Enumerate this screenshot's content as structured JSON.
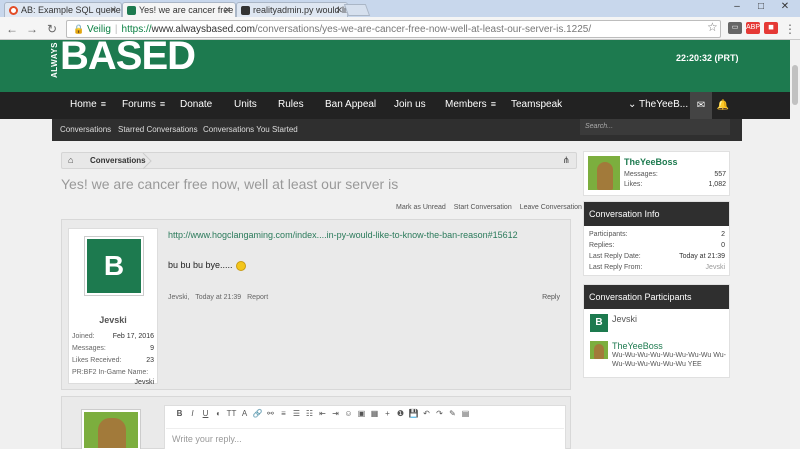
{
  "browser": {
    "tabs": [
      {
        "title": "AB: Example SQL queries",
        "active": false,
        "favicon_color": "#e34c26"
      },
      {
        "title": "Yes! we are cancer free n",
        "active": true,
        "favicon_color": "#1d7a4f"
      },
      {
        "title": "realityadmin.py would lik",
        "active": false,
        "favicon_color": "#333333"
      }
    ],
    "window_controls": [
      "–",
      "□",
      "✕"
    ],
    "secure_label": "Veilig",
    "url_scheme": "https://",
    "url_host": "www.alwaysbased.com",
    "url_path": "/conversations/yes-we-are-cancer-free-now-well-at-least-our-server-is.1225/"
  },
  "site": {
    "logo_small": "ALWAYS",
    "logo_big": "BASED",
    "clock": "22:20:32 (PRT)",
    "accent_color": "#1d7a4f"
  },
  "nav": {
    "items": [
      "Home",
      "Forums",
      "Donate",
      "Units",
      "Rules",
      "Ban Appeal",
      "Join us",
      "Members",
      "Teamspeak"
    ],
    "user": "TheYeeB...",
    "menu_glyph": "≡"
  },
  "subnav": {
    "items": [
      "Conversations",
      "Starred Conversations",
      "Conversations You Started"
    ],
    "search_placeholder": "Search..."
  },
  "breadcrumb": {
    "item": "Conversations"
  },
  "thread": {
    "title": "Yes! we are cancer free now, well at least our server is",
    "actions": [
      "Mark as Unread",
      "Start Conversation",
      "Leave Conversation"
    ]
  },
  "message": {
    "author": "Jevski",
    "avatar_letter": "B",
    "stats": [
      {
        "label": "Joined:",
        "value": "Feb 17, 2016"
      },
      {
        "label": "Messages:",
        "value": "9"
      },
      {
        "label": "Likes Received:",
        "value": "23"
      },
      {
        "label": "PR:BF2 In-Game Name:",
        "value": "Jevski"
      }
    ],
    "link": "http://www.hogclangaming.com/index....in-py-would-like-to-know-the-ban-reason#15612",
    "text": "bu bu bu bye.....",
    "meta_author": "Jevski,",
    "meta_time": "Today at 21:39",
    "report": "Report",
    "reply": "Reply"
  },
  "reply_editor": {
    "toolbar": [
      "B",
      "I",
      "U",
      "◐",
      "TT",
      "A",
      "🔗",
      "⚯",
      "≡",
      "☰",
      "☷",
      "⇤",
      "⇥",
      "☺",
      "▣",
      "▦",
      "+",
      "❶",
      "💾",
      "↶",
      "↷",
      "✎",
      "▤"
    ],
    "placeholder": "Write your reply..."
  },
  "sidebar": {
    "user": {
      "name": "TheYeeBoss",
      "stats": [
        {
          "label": "Messages:",
          "value": "557"
        },
        {
          "label": "Likes:",
          "value": "1,082"
        }
      ]
    },
    "info": {
      "title": "Conversation Info",
      "rows": [
        {
          "label": "Participants:",
          "value": "2"
        },
        {
          "label": "Replies:",
          "value": "0"
        },
        {
          "label": "Last Reply Date:",
          "value": "Today at 21:39"
        },
        {
          "label": "Last Reply From:",
          "value": "Jevski"
        }
      ]
    },
    "participants": {
      "title": "Conversation Participants",
      "list": [
        {
          "name": "Jevski",
          "avatar_letter": "B",
          "title": ""
        },
        {
          "name": "TheYeeBoss",
          "avatar_letter": "",
          "title": "Wu-Wu-Wu-Wu-Wu-Wu-Wu-Wu Wu-Wu-Wu-Wu-Wu-Wu-Wu YEE"
        }
      ]
    }
  }
}
